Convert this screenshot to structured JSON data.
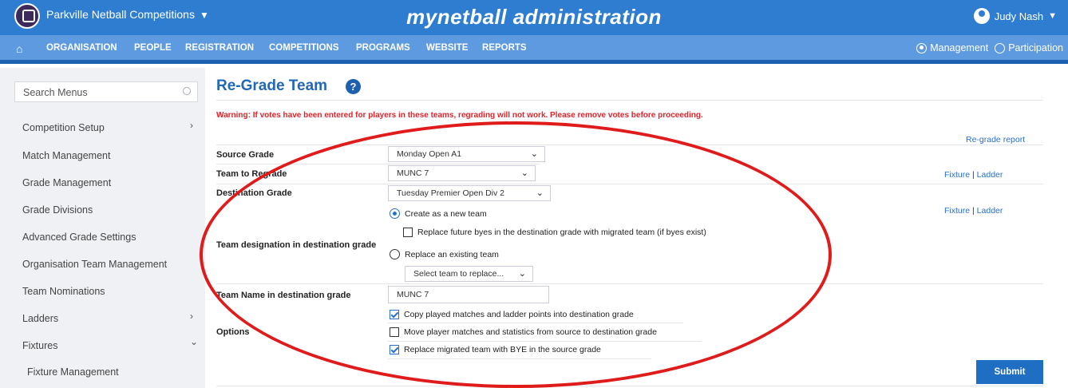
{
  "header": {
    "org_name": "Parkville Netball Competitions",
    "app_title": "mynetball administration",
    "user_name": "Judy Nash"
  },
  "nav": {
    "items": [
      "ORGANISATION",
      "PEOPLE",
      "REGISTRATION",
      "COMPETITIONS",
      "PROGRAMS",
      "WEBSITE",
      "REPORTS"
    ],
    "mode_management": "Management",
    "mode_participation": "Participation",
    "mode_selected": "Management"
  },
  "sidebar": {
    "search_placeholder": "Search Menus",
    "items": [
      {
        "label": "Competition Setup"
      },
      {
        "label": "Match Management"
      },
      {
        "label": "Grade Management"
      },
      {
        "label": "Grade Divisions"
      },
      {
        "label": "Advanced Grade Settings"
      },
      {
        "label": "Organisation Team Management"
      },
      {
        "label": "Team Nominations"
      },
      {
        "label": "Ladders"
      },
      {
        "label": "Fixtures"
      },
      {
        "label": "Fixture Management"
      }
    ]
  },
  "page": {
    "title": "Re-Grade Team",
    "warning": "Warning: If votes have been entered for players in these teams, regrading will not work. Please remove votes before proceeding.",
    "regrade_report": "Re-grade report",
    "fixture": "Fixture",
    "ladder": "Ladder",
    "separator": "|"
  },
  "form": {
    "source_grade_label": "Source Grade",
    "source_grade_value": "Monday Open A1",
    "team_label": "Team to Regrade",
    "team_value": "MUNC 7",
    "dest_grade_label": "Destination Grade",
    "dest_grade_value": "Tuesday Premier Open Div 2",
    "designation_label": "Team designation in destination grade",
    "create_new": "Create as a new team",
    "replace_byes": "Replace future byes in the destination grade with migrated team (if byes exist)",
    "replace_existing": "Replace an existing team",
    "select_team_placeholder": "Select team to replace...",
    "team_name_label": "Team Name in destination grade",
    "team_name_value": "MUNC 7",
    "options_label": "Options",
    "opt_copy": "Copy played matches and ladder points into destination grade",
    "opt_move": "Move player matches and statistics from source to destination grade",
    "opt_replace_bye": "Replace migrated team with BYE in the source grade",
    "submit": "Submit"
  }
}
